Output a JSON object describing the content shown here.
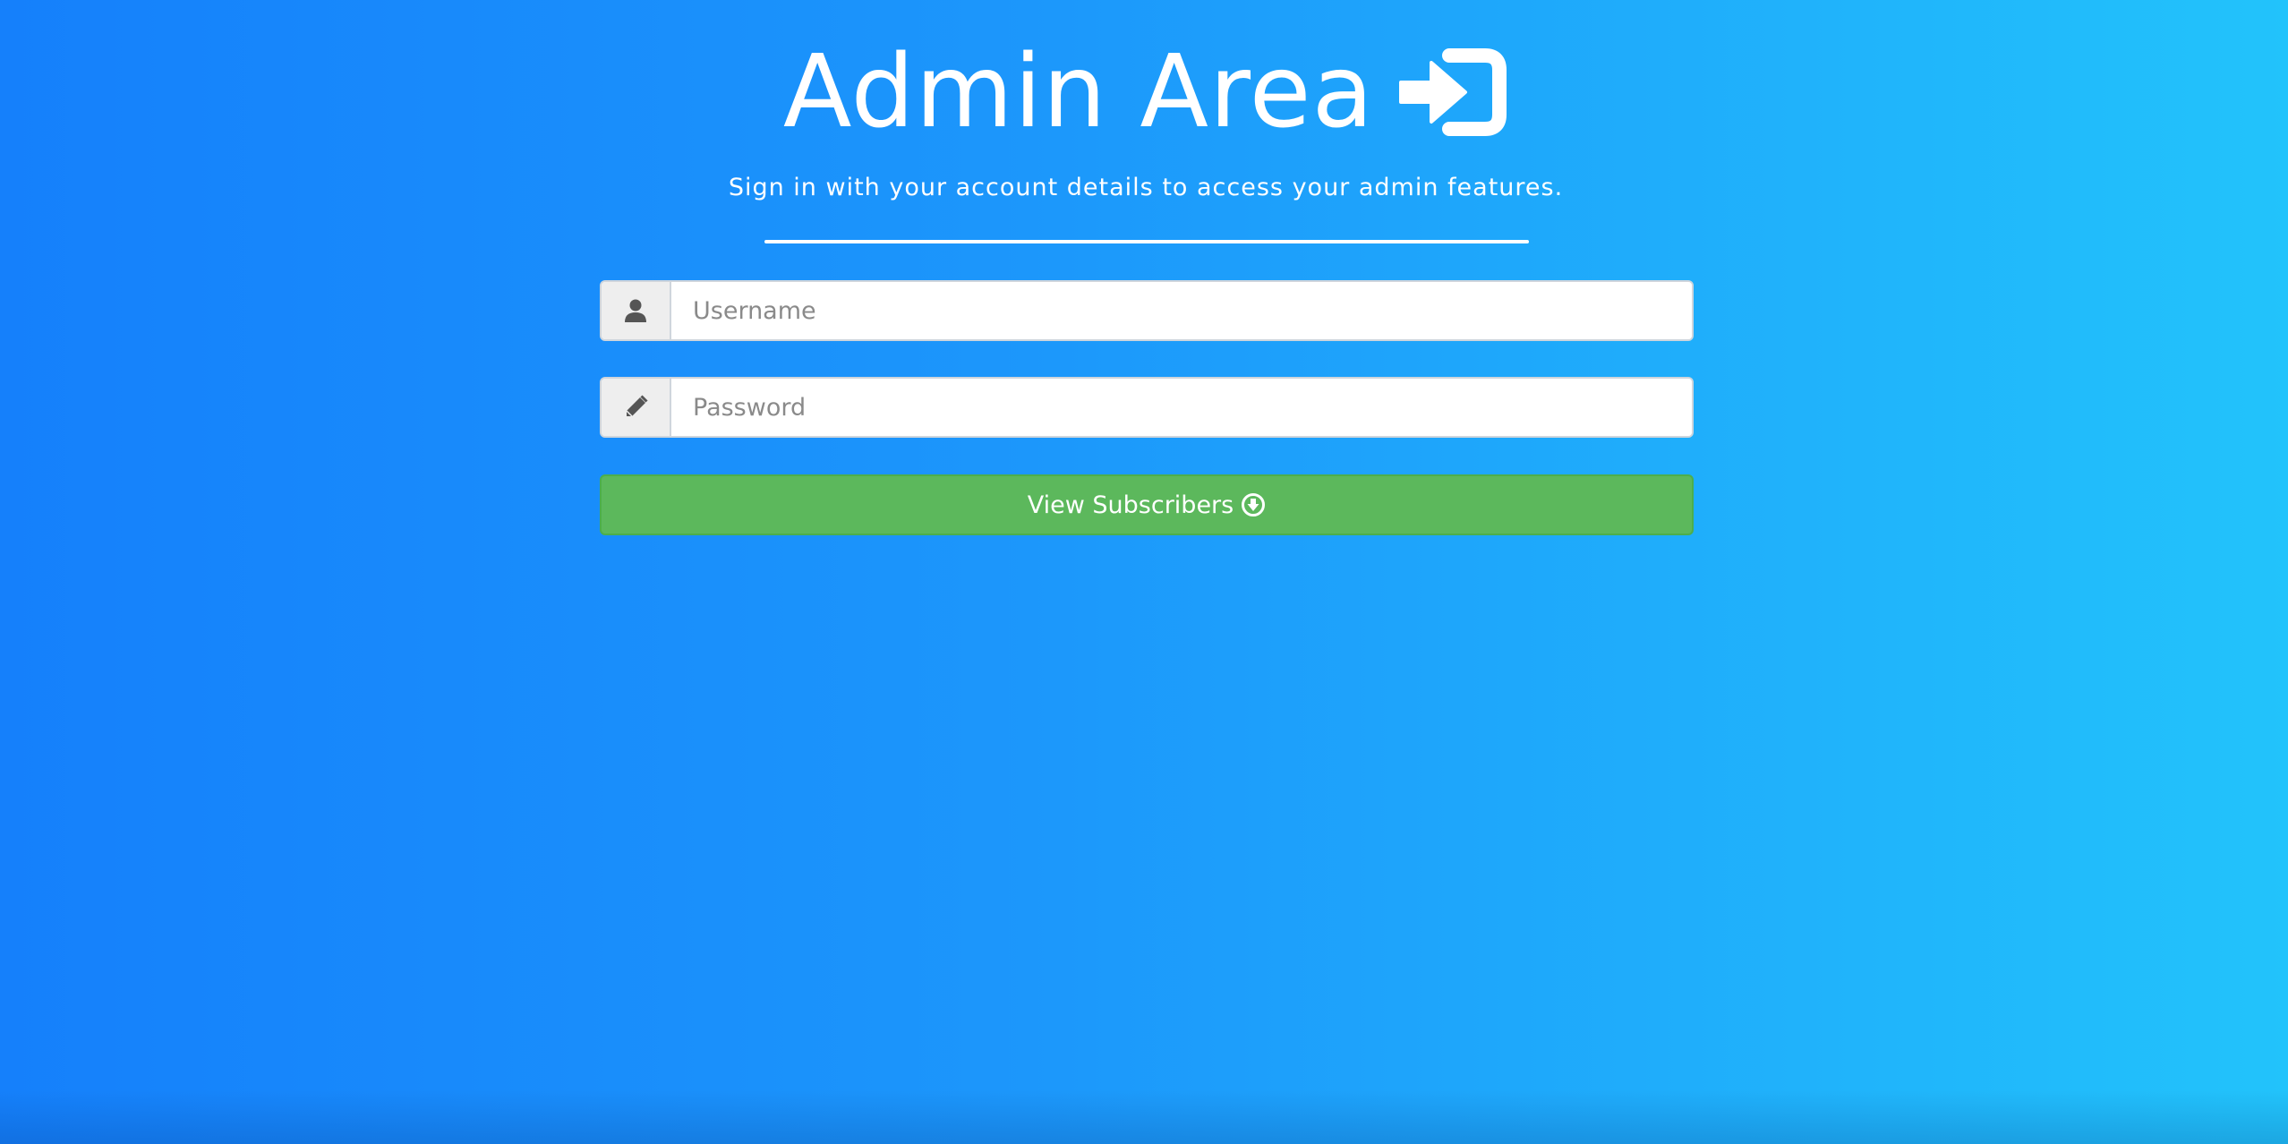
{
  "header": {
    "title": "Admin Area",
    "title_icon": "sign-in-icon",
    "subtitle": "Sign in with your account details to access your admin features."
  },
  "form": {
    "username": {
      "icon": "user-icon",
      "placeholder": "Username",
      "value": ""
    },
    "password": {
      "icon": "pencil-icon",
      "placeholder": "Password",
      "value": ""
    },
    "submit": {
      "label": "View Subscribers",
      "icon": "circle-arrow-down-icon"
    }
  },
  "colors": {
    "background_start": "#1580fb",
    "background_end": "#22c3fb",
    "button": "#5cb85c",
    "addon": "#eeeeee"
  }
}
